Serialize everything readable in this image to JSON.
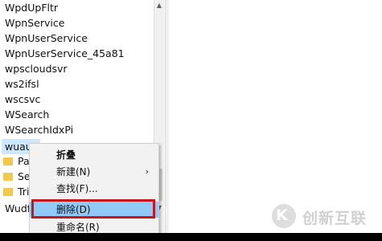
{
  "tree": {
    "items": [
      "WpdUpFltr",
      "WpnService",
      "WpnUserService",
      "WpnUserService_45a81",
      "wpscloudsvr",
      "ws2ifsl",
      "wscsvc",
      "WSearch",
      "WSearchIdxPi"
    ],
    "selected": "wuaus",
    "subitems": [
      "Par",
      "Sec",
      "Trig"
    ],
    "last": "Wudfl"
  },
  "context_menu": {
    "collapse": "折叠",
    "new": "新建(N)",
    "find": "查找(F)...",
    "delete": "删除(D)",
    "rename": "重命名(R)",
    "submenu_arrow": "›"
  },
  "scrollbar": {
    "up": "▲",
    "down": "▼"
  },
  "watermark": {
    "logo": "K",
    "text": "创新互联"
  },
  "colors": {
    "highlight": "#91c9f7",
    "selection": "#cce8ff",
    "annotation": "#c8161d",
    "folder": "#f2c94c"
  }
}
